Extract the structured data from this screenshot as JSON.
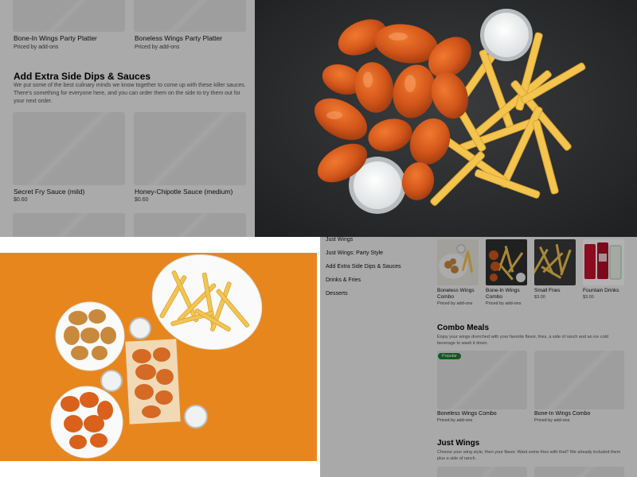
{
  "menu_top": {
    "items_row1": [
      {
        "name": "Bone-In Wings Party Platter",
        "price": "Priced by add-ons"
      },
      {
        "name": "Boneless Wings Party Platter",
        "price": "Priced by add-ons"
      }
    ],
    "dips_section": {
      "title": "Add Extra Side Dips & Sauces",
      "description": "We put some of the best culinary minds we know together to come up with these killer sauces. There's something for everyone here, and you can order them on the side to try them out for your next order."
    },
    "items_row2": [
      {
        "name": "Secret Fry Sauce (mild)",
        "price": "$0.60"
      },
      {
        "name": "Honey-Chipotle Sauce (medium)",
        "price": "$0.60"
      }
    ]
  },
  "menu_bottom": {
    "sidebar": [
      "Just Wings",
      "Just Wings: Party Style",
      "Add Extra Side Dips & Sauces",
      "Drinks & Fries",
      "Desserts"
    ],
    "thumb_items": [
      {
        "name": "Boneless Wings Combo",
        "price": "Priced by add-ons"
      },
      {
        "name": "Bone-In Wings Combo",
        "price": "Priced by add-ons"
      },
      {
        "name": "Small Fries",
        "price": "$3.00"
      },
      {
        "name": "Fountain Drinks",
        "price": "$3.00"
      }
    ],
    "combo_section": {
      "title": "Combo Meals",
      "description": "Enjoy your wings drenched with your favorite flavor, fries, a side of ranch and an ice cold beverage to wash it down.",
      "badge": "Popular",
      "items": [
        {
          "name": "Boneless Wings Combo",
          "price": "Priced by add-ons"
        },
        {
          "name": "Bone-In Wings Combo",
          "price": "Priced by add-ons"
        }
      ]
    },
    "just_wings_section": {
      "title": "Just Wings",
      "description": "Choose your wing style, then your flavor. Want some fries with that? We already included them plus a side of ranch."
    }
  },
  "colors": {
    "overlay": "#000000",
    "popular_badge": "#1e7d32",
    "orange_backdrop": "#e8861e",
    "dark_backdrop": "#2b2d2e",
    "wing_sauce": "#d65a1c",
    "fries": "#f2c24a"
  }
}
